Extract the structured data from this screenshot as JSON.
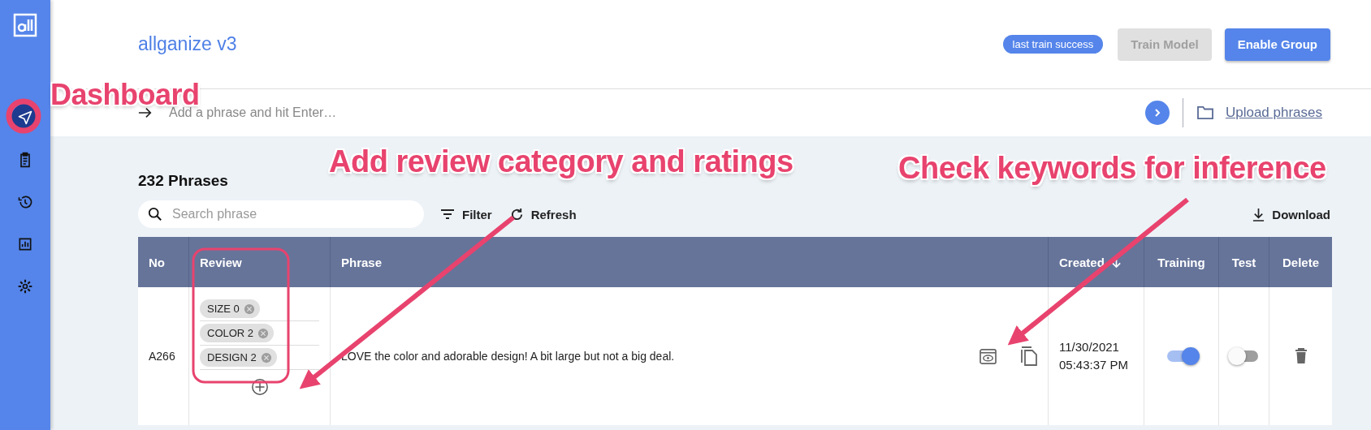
{
  "sidebar": {
    "items": [
      {
        "selected": true
      },
      {
        "selected": false
      },
      {
        "selected": false
      },
      {
        "selected": false
      },
      {
        "selected": false
      }
    ]
  },
  "header": {
    "title": "allganize v3",
    "status_badge": "last train success",
    "buttons": [
      {
        "label": "Train Model",
        "disabled": true
      },
      {
        "label": "Enable Group",
        "disabled": false
      }
    ]
  },
  "phrase_input": {
    "placeholder": "Add a phrase and hit Enter…",
    "upload_link": "Upload phrases"
  },
  "list": {
    "title": "232 Phrases",
    "search": {
      "placeholder": "Search phrase"
    },
    "tools": [
      "Filter",
      "Refresh"
    ],
    "download": "Download"
  },
  "table": {
    "columns": [
      {
        "label": "No",
        "sorted": false
      },
      {
        "label": "Review",
        "sorted": false
      },
      {
        "label": "Phrase",
        "sorted": false
      },
      {
        "label": "Created",
        "sorted": true
      },
      {
        "label": "Training",
        "sorted": false
      },
      {
        "label": "Test",
        "sorted": false
      },
      {
        "label": "Delete",
        "sorted": false
      }
    ],
    "rows": [
      {
        "no": "A266",
        "reviews": [
          "SIZE 0",
          "COLOR 2",
          "DESIGN 2"
        ],
        "phrase": "LOVE the color and adorable design! A bit large but not a big deal.",
        "created": [
          "11/30/2021",
          "05:43:37 PM"
        ],
        "training": true,
        "test": false
      }
    ]
  },
  "annotations": [
    {
      "text": "Dashboard"
    },
    {
      "text": "Add review category and ratings"
    },
    {
      "text": "Check keywords for inference"
    }
  ]
}
